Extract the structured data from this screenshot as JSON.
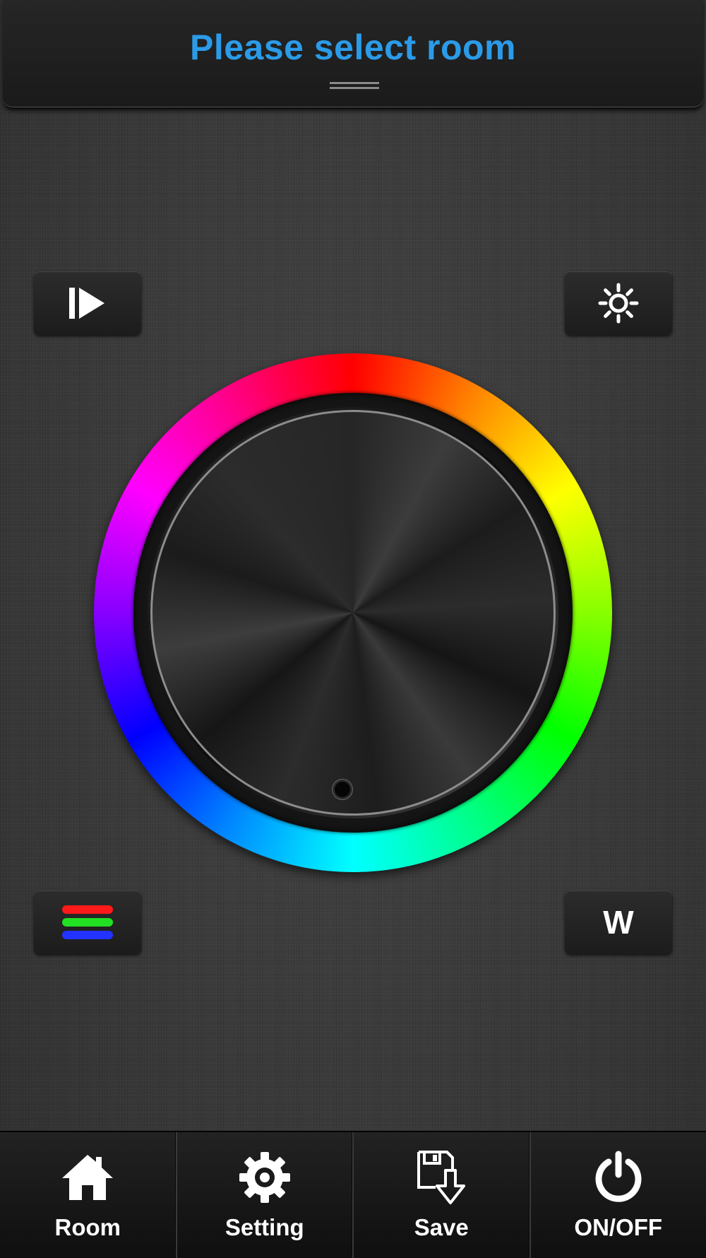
{
  "header": {
    "title": "Please select room"
  },
  "controls": {
    "play_icon": "play-pause-icon",
    "brightness_icon": "sun-icon",
    "rgb_icon": "rgb-bars-icon",
    "white_label": "W"
  },
  "color_wheel": {
    "colors": [
      "#ff0000",
      "#ffff00",
      "#00ff00",
      "#00ffff",
      "#0000ff",
      "#ff00ff"
    ]
  },
  "tabbar": {
    "tabs": [
      {
        "label": "Room",
        "icon": "home-icon"
      },
      {
        "label": "Setting",
        "icon": "gear-icon"
      },
      {
        "label": "Save",
        "icon": "save-icon"
      },
      {
        "label": "ON/OFF",
        "icon": "power-icon"
      }
    ]
  },
  "colors": {
    "title": "#2b9be8",
    "rgb_red": "#ff1a1a",
    "rgb_green": "#22e022",
    "rgb_blue": "#2233ff"
  }
}
